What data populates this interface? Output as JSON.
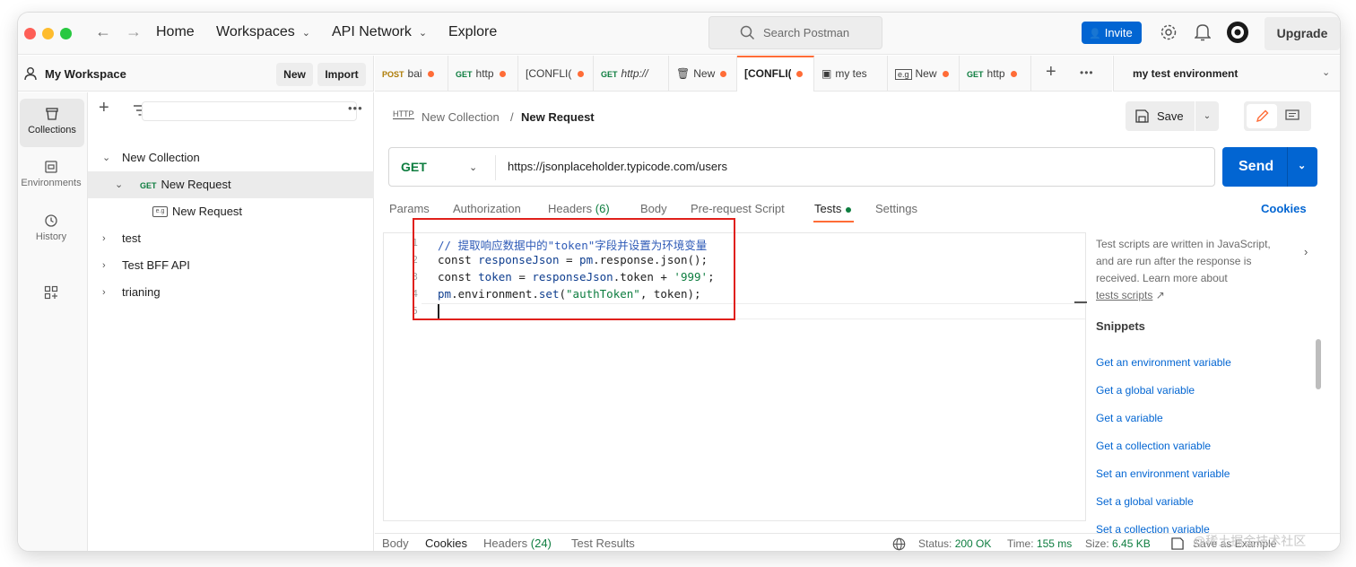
{
  "titlebar": {
    "nav": [
      {
        "label": "Home",
        "has_dropdown": false
      },
      {
        "label": "Workspaces",
        "has_dropdown": true
      },
      {
        "label": "API Network",
        "has_dropdown": true
      },
      {
        "label": "Explore",
        "has_dropdown": false
      }
    ],
    "search_placeholder": "Search Postman",
    "invite_label": "Invite",
    "upgrade_label": "Upgrade",
    "accent_color": "#0265d2"
  },
  "workspace": {
    "name": "My Workspace",
    "new_label": "New",
    "import_label": "Import"
  },
  "rail": [
    {
      "label": "Collections",
      "icon": "trash-can-icon",
      "active": true
    },
    {
      "label": "Environments",
      "icon": "environments-icon",
      "active": false
    },
    {
      "label": "History",
      "icon": "history-icon",
      "active": false
    },
    {
      "label": "",
      "icon": "grid-plus-icon",
      "active": false
    }
  ],
  "tree": [
    {
      "label": "New Collection",
      "level": 0,
      "expanded": true
    },
    {
      "label": "New Request",
      "method": "GET",
      "level": 1,
      "expanded": true,
      "selected": true
    },
    {
      "label": "New Request",
      "method": "e.g",
      "level": 2
    },
    {
      "label": "test",
      "level": 0,
      "expanded": false
    },
    {
      "label": "Test BFF API",
      "level": 0,
      "expanded": false
    },
    {
      "label": "trianing",
      "level": 0,
      "expanded": false
    }
  ],
  "tabs": [
    {
      "method": "POST",
      "label": "bai",
      "dot": true
    },
    {
      "method": "GET",
      "label": "http",
      "dot": true
    },
    {
      "method": "",
      "label": "[CONFLI(",
      "dot": true
    },
    {
      "method": "GET",
      "label": "http://",
      "dot": false
    },
    {
      "method": "",
      "label": "New",
      "dot": true
    },
    {
      "method": "",
      "label": "[CONFLI(",
      "dot": true,
      "active": true
    },
    {
      "method": "",
      "label": "my tes",
      "dot": false
    },
    {
      "method": "",
      "label": "New",
      "dot": true
    },
    {
      "method": "GET",
      "label": "http",
      "dot": true
    }
  ],
  "environment": {
    "selected": "my test environment"
  },
  "request": {
    "breadcrumb_parent": "New Collection",
    "breadcrumb_sep": "/",
    "breadcrumb_current": "New Request",
    "save_label": "Save",
    "method": "GET",
    "url": "https://jsonplaceholder.typicode.com/users",
    "send_label": "Send",
    "tabs": [
      {
        "label": "Params"
      },
      {
        "label": "Authorization"
      },
      {
        "label": "Headers",
        "count": "(6)"
      },
      {
        "label": "Body"
      },
      {
        "label": "Pre-request Script"
      },
      {
        "label": "Tests",
        "active": true,
        "dot": true
      },
      {
        "label": "Settings"
      }
    ],
    "cookies_label": "Cookies"
  },
  "editor": {
    "line_numbers": [
      "1",
      "2",
      "3",
      "4",
      "5"
    ],
    "lines": [
      [
        {
          "t": "// 提取响应数据中的\"token\"字段并设置为环境变量",
          "c": "comment"
        }
      ],
      [
        {
          "t": "const ",
          "c": "kw"
        },
        {
          "t": "responseJson",
          "c": "var"
        },
        {
          "t": " = ",
          "c": "kw"
        },
        {
          "t": "pm",
          "c": "var"
        },
        {
          "t": ".response.json();",
          "c": "kw"
        }
      ],
      [
        {
          "t": "const ",
          "c": "kw"
        },
        {
          "t": "token",
          "c": "var"
        },
        {
          "t": " = ",
          "c": "kw"
        },
        {
          "t": "responseJson",
          "c": "var"
        },
        {
          "t": ".token + ",
          "c": "kw"
        },
        {
          "t": "'999'",
          "c": "str"
        },
        {
          "t": ";",
          "c": "kw"
        }
      ],
      [
        {
          "t": "pm",
          "c": "var"
        },
        {
          "t": ".environment.",
          "c": "kw"
        },
        {
          "t": "set",
          "c": "var"
        },
        {
          "t": "(",
          "c": "kw"
        },
        {
          "t": "\"authToken\"",
          "c": "str"
        },
        {
          "t": ", token);",
          "c": "kw"
        }
      ],
      []
    ],
    "highlight_color": "#e0201b"
  },
  "help": {
    "text": "Test scripts are written in JavaScript, and are run after the response is received. Learn more about",
    "link": "tests scripts",
    "link_arrow": "↗",
    "snippets_title": "Snippets",
    "snippets": [
      "Get an environment variable",
      "Get a global variable",
      "Get a variable",
      "Get a collection variable",
      "Set an environment variable",
      "Set a global variable",
      "Set a collection variable"
    ]
  },
  "response": {
    "tabs": [
      {
        "label": "Body"
      },
      {
        "label": "Cookies",
        "active": true
      },
      {
        "label": "Headers",
        "count": "(24)"
      },
      {
        "label": "Test Results"
      }
    ],
    "status_label": "Status:",
    "status_value": "200 OK",
    "time_label": "Time:",
    "time_value": "155 ms",
    "size_label": "Size:",
    "size_value": "6.45 KB",
    "save_example": "Save as Example"
  },
  "watermark": "@稀土掘金技术社区"
}
